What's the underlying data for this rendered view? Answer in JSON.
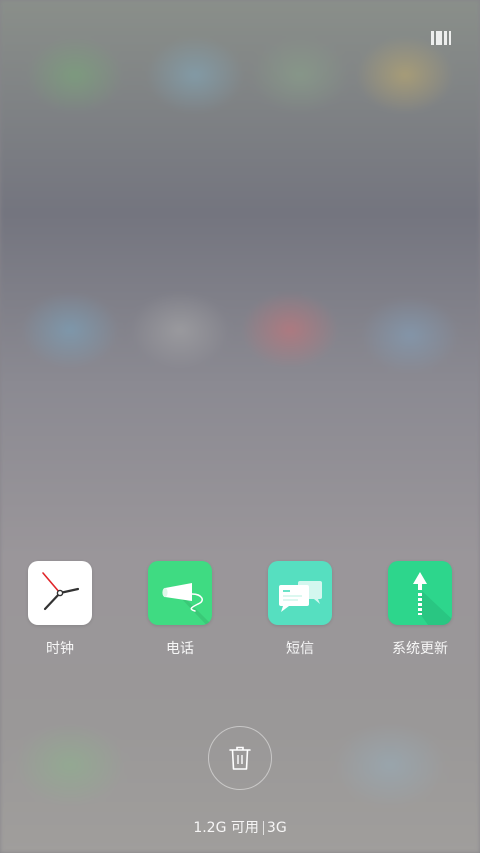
{
  "recent_apps": [
    {
      "name": "时钟",
      "icon": "clock-icon",
      "tile_color": "#ffffff"
    },
    {
      "name": "电话",
      "icon": "phone-icon",
      "tile_color": "#3fdb82"
    },
    {
      "name": "短信",
      "icon": "message-icon",
      "tile_color": "#56dfc0"
    },
    {
      "name": "系统更新",
      "icon": "update-arrow-icon",
      "tile_color": "#2dd68c"
    }
  ],
  "memory": {
    "available": "1.2G 可用",
    "total": "3G"
  },
  "controls": {
    "clear_icon": "trash-icon",
    "switch_icon": "layout-switch-icon"
  }
}
